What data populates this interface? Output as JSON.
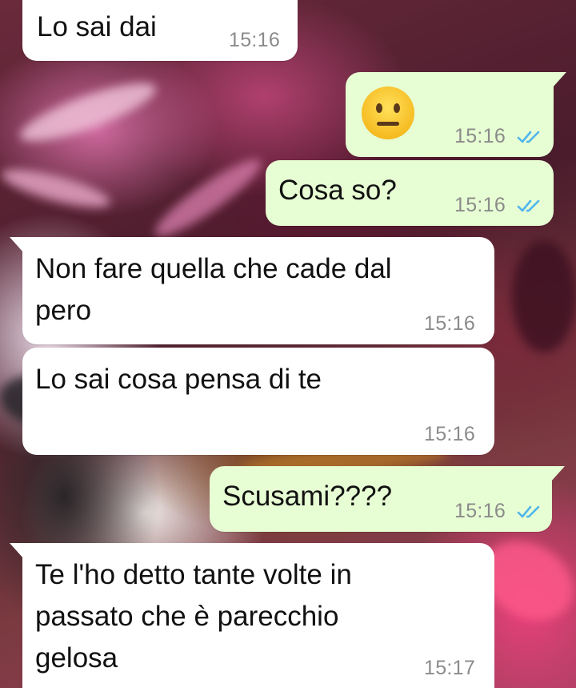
{
  "chat": {
    "messages": [
      {
        "direction": "incoming",
        "text": "Lo sai dai",
        "time": "15:16"
      },
      {
        "direction": "outgoing",
        "emoji": "neutral-face",
        "time": "15:16",
        "status": "read"
      },
      {
        "direction": "outgoing",
        "text": "Cosa so?",
        "time": "15:16",
        "status": "read"
      },
      {
        "direction": "incoming",
        "text": "Non fare quella che cade dal\npero",
        "time": "15:16"
      },
      {
        "direction": "incoming",
        "text": "Lo sai cosa pensa di te",
        "time": "15:16"
      },
      {
        "direction": "outgoing",
        "text": "Scusami????",
        "time": "15:16",
        "status": "read"
      },
      {
        "direction": "incoming",
        "text": "Te l'ho detto tante volte in\npassato che è parecchio\ngelosa",
        "time": "15:17"
      }
    ]
  },
  "colors": {
    "incoming_bubble": "#ffffff",
    "outgoing_bubble": "#e7fdd3",
    "read_ticks": "#4fb6ec",
    "timestamp": "#8b8b8b"
  },
  "icons": {
    "read_status": "double-check-icon",
    "emoji": "neutral-face-emoji-icon"
  }
}
